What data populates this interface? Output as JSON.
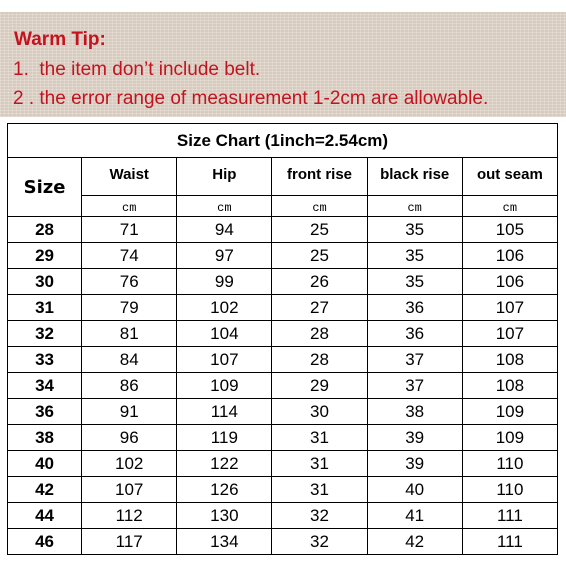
{
  "tip": {
    "title": "Warm Tip:",
    "lines": [
      "1.  the item don’t include belt.",
      "2 . the error range of measurement 1-2cm are allowable."
    ],
    "color": "#c4121f"
  },
  "table": {
    "title": "Size Chart (1inch=2.54cm)",
    "size_header": "Size",
    "columns": [
      "Waist",
      "Hip",
      "front rise",
      "black rise",
      "out seam"
    ],
    "unit": "cm",
    "rows": [
      {
        "size": "28",
        "values": [
          "71",
          "94",
          "25",
          "35",
          "105"
        ]
      },
      {
        "size": "29",
        "values": [
          "74",
          "97",
          "25",
          "35",
          "106"
        ]
      },
      {
        "size": "30",
        "values": [
          "76",
          "99",
          "26",
          "35",
          "106"
        ]
      },
      {
        "size": "31",
        "values": [
          "79",
          "102",
          "27",
          "36",
          "107"
        ]
      },
      {
        "size": "32",
        "values": [
          "81",
          "104",
          "28",
          "36",
          "107"
        ]
      },
      {
        "size": "33",
        "values": [
          "84",
          "107",
          "28",
          "37",
          "108"
        ]
      },
      {
        "size": "34",
        "values": [
          "86",
          "109",
          "29",
          "37",
          "108"
        ]
      },
      {
        "size": "36",
        "values": [
          "91",
          "114",
          "30",
          "38",
          "109"
        ]
      },
      {
        "size": "38",
        "values": [
          "96",
          "119",
          "31",
          "39",
          "109"
        ]
      },
      {
        "size": "40",
        "values": [
          "102",
          "122",
          "31",
          "39",
          "110"
        ]
      },
      {
        "size": "42",
        "values": [
          "107",
          "126",
          "31",
          "40",
          "110"
        ]
      },
      {
        "size": "44",
        "values": [
          "112",
          "130",
          "32",
          "41",
          "111"
        ]
      },
      {
        "size": "46",
        "values": [
          "117",
          "134",
          "32",
          "42",
          "111"
        ]
      }
    ]
  }
}
